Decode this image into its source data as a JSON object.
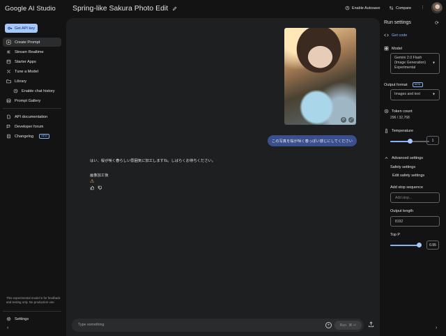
{
  "app": {
    "brand": "Google AI Studio"
  },
  "header": {
    "title": "Spring-like Sakura Photo Edit",
    "autosave_label": "Enable Autosave",
    "compare_label": "Compare"
  },
  "sidebar": {
    "api_key_label": "Get API key",
    "items": [
      {
        "label": "Create Prompt",
        "icon": "add-icon",
        "active": true
      },
      {
        "label": "Stream Realtime",
        "icon": "stream-icon"
      },
      {
        "label": "Starter Apps",
        "icon": "apps-icon"
      },
      {
        "label": "Tune a Model",
        "icon": "tune-icon"
      },
      {
        "label": "Library",
        "icon": "folder-icon"
      },
      {
        "label": "Enable chat history",
        "icon": "history-icon"
      },
      {
        "label": "Prompt Gallery",
        "icon": "gallery-icon"
      }
    ],
    "links": [
      {
        "label": "API documentation",
        "icon": "document-icon"
      },
      {
        "label": "Developer forum",
        "icon": "forum-icon"
      },
      {
        "label": "Changelog",
        "icon": "changelog-icon",
        "badge": "NEW"
      }
    ],
    "note": "This experimental model is for feedback and testing only. No production use.",
    "settings_label": "Settings"
  },
  "chat": {
    "user_message": "この写真を桜が咲く春っぽい感じにしてください",
    "model_message": "はい、桜が咲く春らしい雰囲気に加工しますね。しばらくお待ちください。",
    "model_label": "画像加工後",
    "input_placeholder": "Type something",
    "run_label": "Run",
    "run_shortcut": "⌘ ↵"
  },
  "run_settings": {
    "title": "Run settings",
    "get_code_label": "Get code",
    "model_label": "Model",
    "model_value": "Gemini 2.0 Flash (Image Generation) Experimental",
    "output_format_label": "Output format",
    "output_format_badge": "NEW",
    "output_format_value": "Images and text",
    "token_count_label": "Token count",
    "token_count_value": "296 / 32,768",
    "temperature_label": "Temperature",
    "temperature_value": "1",
    "temperature_fraction": 0.5,
    "advanced_label": "Advanced settings",
    "safety_label": "Safety settings",
    "edit_safety_label": "Edit safety settings",
    "stop_sequence_label": "Add stop sequence",
    "stop_sequence_placeholder": "Add stop...",
    "output_length_label": "Output length",
    "output_length_value": "8192",
    "top_p_label": "Top P",
    "top_p_value": "0.95",
    "top_p_fraction": 0.95
  },
  "colors": {
    "accent": "#8ab4f8",
    "api_button": "#a8c7fa",
    "user_bubble": "#3b4f8c",
    "panel": "#1e1f20",
    "background": "#131314"
  }
}
